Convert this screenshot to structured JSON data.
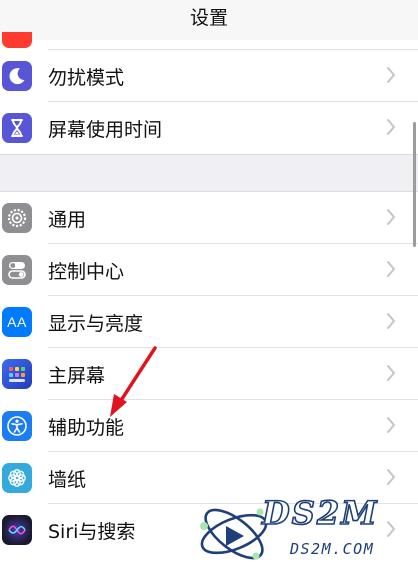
{
  "nav": {
    "title": "设置"
  },
  "group1": [
    {
      "label": "勿扰模式",
      "icon": "moon-icon",
      "color": "#5856d6"
    },
    {
      "label": "屏幕使用时间",
      "icon": "hourglass-icon",
      "color": "#5856d6"
    }
  ],
  "group2": [
    {
      "label": "通用",
      "icon": "gear-icon",
      "color": "#8e8e93"
    },
    {
      "label": "控制中心",
      "icon": "toggles-icon",
      "color": "#8e8e93"
    },
    {
      "label": "显示与亮度",
      "icon": "text-size-icon",
      "icon_text": "AA",
      "color": "#007aff"
    },
    {
      "label": "主屏幕",
      "icon": "home-grid-icon",
      "color": "#2d4fd6"
    },
    {
      "label": "辅助功能",
      "icon": "accessibility-icon",
      "color": "#1c7cf4"
    },
    {
      "label": "墙纸",
      "icon": "flower-icon",
      "color": "#34aadc"
    },
    {
      "label": "Siri与搜索",
      "icon": "siri-icon",
      "color": "#1a1a2e"
    }
  ],
  "watermark": {
    "logo": "DS2M",
    "url": "DS2M.COM"
  },
  "colors": {
    "arrow": "#e0141e",
    "chevron": "#c4c4c9"
  }
}
